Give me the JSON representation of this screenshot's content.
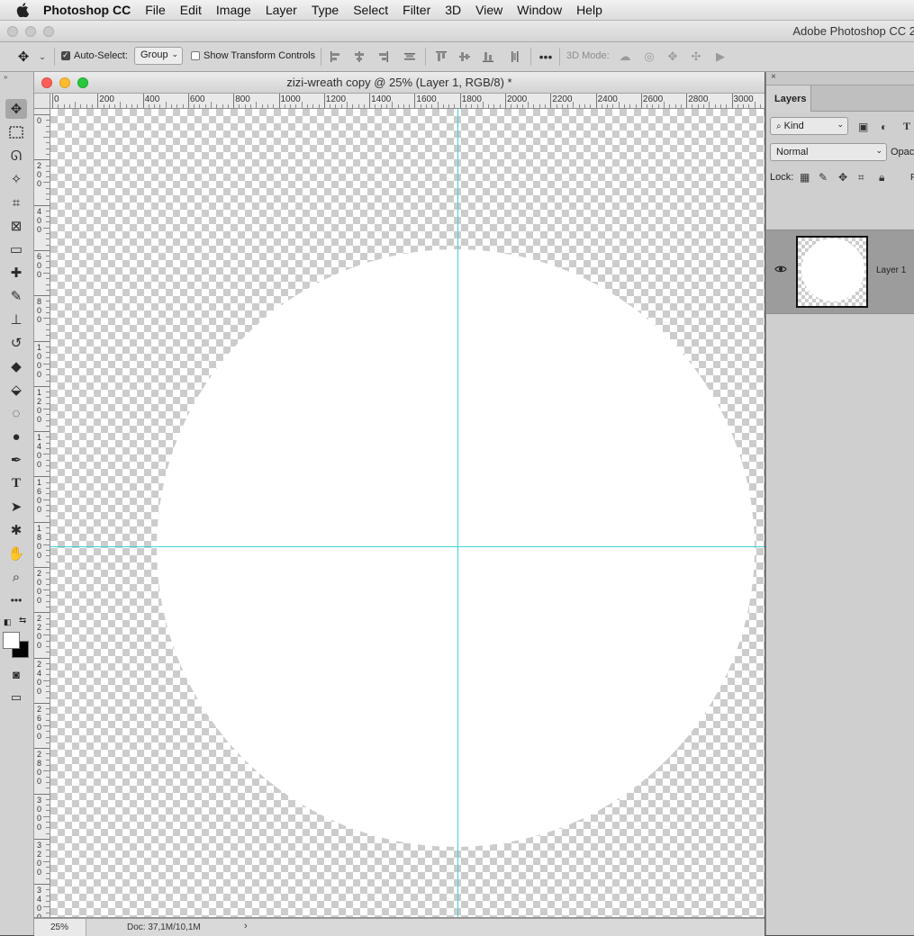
{
  "menubar": {
    "app_name": "Photoshop CC",
    "items": [
      "File",
      "Edit",
      "Image",
      "Layer",
      "Type",
      "Select",
      "Filter",
      "3D",
      "View",
      "Window",
      "Help"
    ]
  },
  "titlebar": {
    "title": "Adobe Photoshop CC 2"
  },
  "options": {
    "auto_select_label": "Auto-Select:",
    "auto_select_checked": true,
    "group_value": "Group",
    "show_transform_label": "Show Transform Controls",
    "show_transform_checked": false,
    "mode_3d_label": "3D Mode:"
  },
  "document": {
    "title": "zizi-wreath copy @ 25% (Layer 1, RGB/8) *",
    "hruler_labels": [
      "0",
      "200",
      "400",
      "600",
      "800",
      "1000",
      "1200",
      "1400",
      "1600",
      "1800",
      "2000",
      "2200",
      "2400",
      "2600",
      "2800",
      "3000"
    ],
    "vruler_labels": [
      "0",
      "200",
      "400",
      "600",
      "800",
      "1000",
      "1200",
      "1400",
      "1600",
      "1800",
      "2000",
      "2200",
      "2400",
      "2600",
      "2800",
      "3000",
      "3200",
      "3400"
    ],
    "zoom": "25%",
    "doc_info": "Doc: 37,1M/10,1M",
    "status_arrow": "›"
  },
  "layers_panel": {
    "close_glyph": "×",
    "tab_label": "Layers",
    "filter_value": "Kind",
    "blend_mode": "Normal",
    "opacity_label": "Opaci",
    "lock_label": "Lock:",
    "fill_label": "F",
    "layers": [
      {
        "name": "Layer 1",
        "visible": true
      }
    ]
  },
  "colors": {
    "guide": "#3fd3d8",
    "canvas_fill": "#ffffff",
    "checker": "#cccccc"
  }
}
